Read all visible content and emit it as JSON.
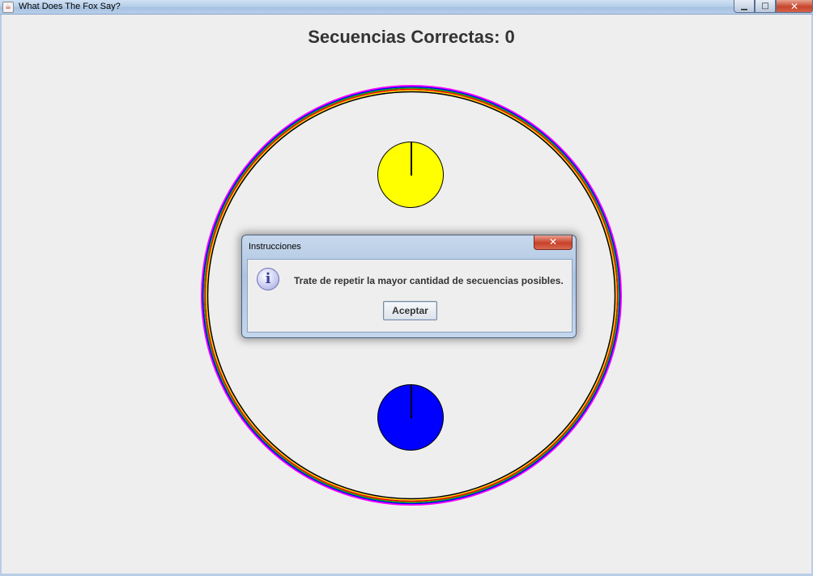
{
  "window": {
    "title": "What Does The Fox Say?",
    "app_icon": "java-cup-icon",
    "controls": {
      "minimize": "▁",
      "maximize": "□",
      "close": "✕"
    }
  },
  "game": {
    "score_label": "Secuencias Correctas:  0",
    "lights": [
      {
        "color": "#ffff00",
        "name": "yellow"
      },
      {
        "color": "#0000ff",
        "name": "blue"
      }
    ]
  },
  "dialog": {
    "title": "Instrucciones",
    "close": "✕",
    "icon": "info-icon",
    "icon_glyph": "i",
    "message": "Trate de repetir la mayor cantidad de secuencias posibles.",
    "ok_label": "Aceptar"
  }
}
